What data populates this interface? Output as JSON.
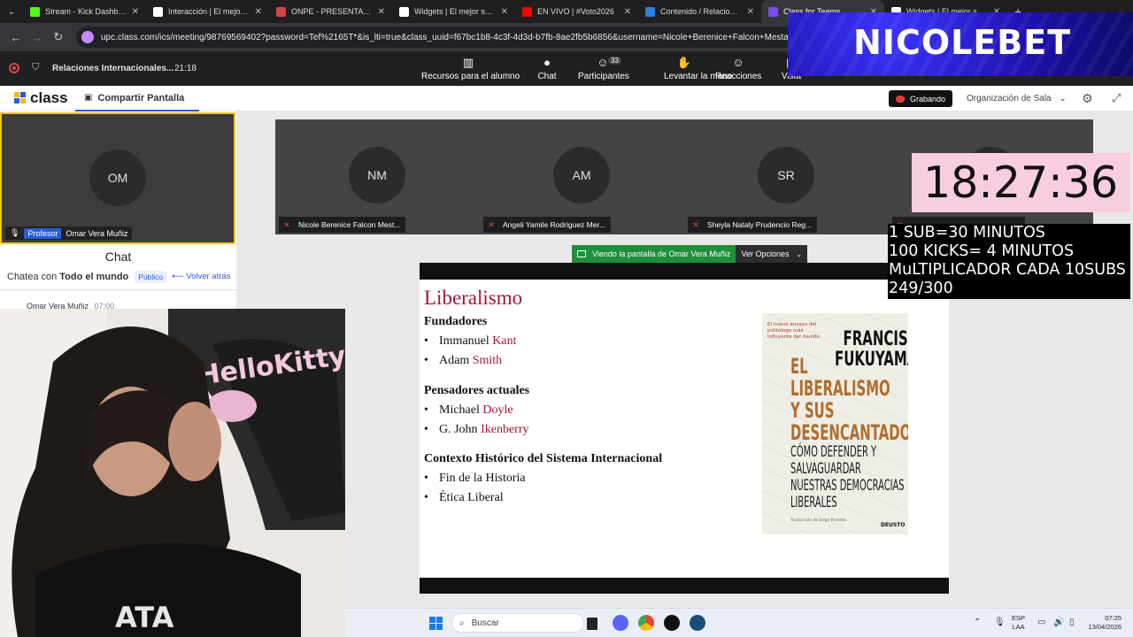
{
  "browser": {
    "tabs": [
      {
        "title": "Stream - Kick Dashboard",
        "color": "#53fc18"
      },
      {
        "title": "Interacción | El mejor soft",
        "color": "#ffffff"
      },
      {
        "title": "ONPE - PRESENTACIÓN D",
        "color": "#d64545"
      },
      {
        "title": "Widgets | El mejor softw",
        "color": "#ffffff"
      },
      {
        "title": "EN VIVO | #Voto2026",
        "color": "#ff0000"
      },
      {
        "title": "Contenido / Relaciones In",
        "color": "#2d7ee0"
      },
      {
        "title": "Class for Teams",
        "color": "#7a4df0"
      },
      {
        "title": "Widgets | El mejor softw",
        "color": "#ffffff"
      }
    ],
    "new_tab": "+",
    "url": "upc.class.com/ics/meeting/98769569402?password=Tef%2165T*&is_lti=true&class_uuid=f67bc1b8-4c3f-4d3d-b7fb-8ae2fb5b6856&username=Nicole+Berenice+Falcon+Mestanza"
  },
  "meeting": {
    "title": "Relaciones Internacionales...",
    "time": "21:18",
    "toolbar": [
      {
        "icon": "bar-chart-icon",
        "glyph": "▥",
        "label": "Recursos para el alumno"
      },
      {
        "icon": "chat-icon",
        "glyph": "●",
        "label": "Chat"
      },
      {
        "icon": "participants-icon",
        "glyph": "☺",
        "label": "Participantes",
        "badge": "33"
      },
      {
        "icon": "hand-icon",
        "glyph": "✋",
        "label": "Levantar la mano"
      },
      {
        "icon": "reaction-icon",
        "glyph": "☺",
        "label": "Reacciones"
      },
      {
        "icon": "view-icon",
        "glyph": "▤",
        "label": "Vista"
      }
    ]
  },
  "overlay": {
    "brand": "NICOLEBET",
    "timer": "18:27:36",
    "rules": [
      "1 SUB=30 MINUTOS",
      "100 KICKS= 4 MINUTOS",
      "MuLTIPLICADOR CADA 10SUBS",
      "249/300"
    ]
  },
  "app": {
    "logo": "class",
    "share_tab": "Compartir Pantalla",
    "recording": "Grabando",
    "room_org": "Organización de Sala"
  },
  "host": {
    "initials": "OM",
    "role": "Profesor",
    "name": "Omar Vera Muñiz"
  },
  "participants": [
    {
      "initials": "NM",
      "name": "Nicole Berenice Falcon Mest..."
    },
    {
      "initials": "AM",
      "name": "Angeli Yamile Rodriguez Mer..."
    },
    {
      "initials": "SR",
      "name": "Sheyla Nataly Prudencio Reg..."
    }
  ],
  "chat": {
    "title": "Chat",
    "prefix": "Chatea con",
    "target": "Todo el mundo",
    "visibility": "Público",
    "back": "Volver atrás",
    "first_sender": "Omar Vera Muñiz",
    "first_time": "07:00"
  },
  "screen_share": {
    "viewing": "Viendo la pantalla de Omar Vera Muñiz",
    "options": "Ver Opciones"
  },
  "slide": {
    "heading": "Liberalismo",
    "sections": [
      {
        "title": "Fundadores",
        "items": [
          {
            "first": "Immanuel",
            "last": "Kant"
          },
          {
            "first": "Adam",
            "last": "Smith"
          }
        ]
      },
      {
        "title": "Pensadores actuales",
        "items": [
          {
            "first": "Michael",
            "last": "Doyle"
          },
          {
            "first": "G. John",
            "last": "Ikenberry"
          }
        ]
      },
      {
        "title": "Contexto Histórico del Sistema Internacional",
        "items": [
          {
            "first": "Fin de la Historia",
            "last": ""
          },
          {
            "first": "Ética Liberal",
            "last": ""
          }
        ]
      }
    ],
    "book": {
      "tag": "El nuevo ensayo del politólogo más influyente del mundo",
      "author": [
        "FRANCIS",
        "FUKUYAMA"
      ],
      "title": [
        "EL",
        "LIBERALISMO",
        "Y SUS",
        "DESENCANTADOS"
      ],
      "subtitle": [
        "CÓMO DEFENDER Y",
        "SALVAGUARDAR",
        "NUESTRAS DEMOCRACIAS",
        "LIBERALES"
      ],
      "translator": "Traducción de Jorge Paredes",
      "publisher": "DEUSTO"
    }
  },
  "taskbar": {
    "search": "Buscar",
    "lang": [
      "ESP",
      "LAA"
    ],
    "time": "07:25",
    "date": "13/04/2026"
  }
}
